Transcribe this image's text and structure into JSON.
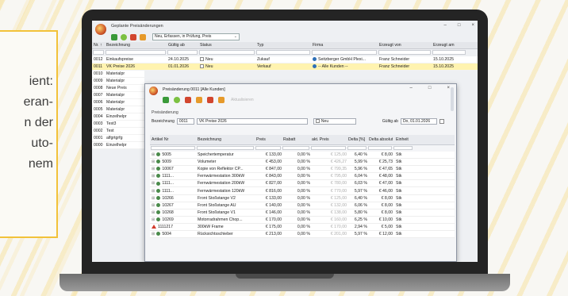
{
  "callout": {
    "lines": [
      "ient:",
      "eran-",
      "n der",
      "uto-",
      "nem"
    ]
  },
  "main_window": {
    "title": "Geplante Preisänderungen",
    "controls": [
      "–",
      "□",
      "×"
    ],
    "filter_value": "Neu, Erfassen, in Prüfung, Preis",
    "columns": [
      "Nr. ↑",
      "Bezeichnung",
      "Gültig ab",
      "Status",
      "Typ",
      "Firma",
      "Erzeugt von",
      "Erzeugt am"
    ],
    "rows": [
      {
        "nr": "0012",
        "bez": "Einkaufspreise",
        "gueltig": "24.10.2025",
        "status": "Neu",
        "typ": "Zukauf",
        "firma": "Seitzberger GmbH Plexi...",
        "von": "Franz Schneider",
        "am": "15.10.2025",
        "highlight": false
      },
      {
        "nr": "0011",
        "bez": "VK Preise 2026",
        "gueltig": "01.01.2026",
        "status": "Neu",
        "typ": "Verkauf",
        "firma": "-- Alle Kunden --",
        "von": "Franz Schneider",
        "am": "15.10.2025",
        "highlight": true
      }
    ],
    "left_rows": [
      {
        "nr": "0010",
        "bez": "Materialpr"
      },
      {
        "nr": "0009",
        "bez": "Materialpr"
      },
      {
        "nr": "0008",
        "bez": "Neue Preis"
      },
      {
        "nr": "0007",
        "bez": "Materialpr"
      },
      {
        "nr": "0006",
        "bez": "Materialpr"
      },
      {
        "nr": "0005",
        "bez": "Materialpr"
      },
      {
        "nr": "0004",
        "bez": "Einzelhelpr"
      },
      {
        "nr": "0003",
        "bez": "Test3"
      },
      {
        "nr": "0002",
        "bez": "Test"
      },
      {
        "nr": "0001",
        "bez": "alfgrtgrfg"
      },
      {
        "nr": "0000",
        "bez": "Einzelhelpr"
      }
    ]
  },
  "dialog": {
    "title": "Preisänderung 0011 [Alle Kunden]",
    "controls": [
      "–",
      "□",
      "×"
    ],
    "toolbar_disabled_label": "Aktualisieren",
    "section": "Preisänderung",
    "bezeichnung_label": "Bezeichnung",
    "nr_value": "0011",
    "bez_value": "VK Preise 2026",
    "status_value": "Neu",
    "gueltig_label": "Gültig ab",
    "gueltig_value": "Do, 01.01.2026",
    "columns": [
      "Artikel Nr",
      "Bezeichnung",
      "Preis",
      "Rabatt",
      "akt. Preis",
      "Delta [%]",
      "Delta absolut",
      "Einheit"
    ],
    "rows": [
      {
        "art": "5005",
        "bez": "Speichertemperatur",
        "preis": "€ 133,00",
        "rabatt": "0,00 %",
        "akt": "€ 125,00",
        "dp": "6,40 %",
        "da": "€ 8,00",
        "eh": "Stk"
      },
      {
        "art": "5009",
        "bez": "Volumeter",
        "preis": "€ 453,00",
        "rabatt": "0,00 %",
        "akt": "€ 426,27",
        "dp": "5,99 %",
        "da": "€ 25,73",
        "eh": "Stk"
      },
      {
        "art": "10067",
        "bez": "Kopie von Reflektor CP...",
        "preis": "€ 847,00",
        "rabatt": "0,00 %",
        "akt": "€ 799,35",
        "dp": "5,96 %",
        "da": "€ 47,65",
        "eh": "Stk"
      },
      {
        "art": "1111...",
        "bez": "Fernwärmestation 300kW",
        "preis": "€ 843,00",
        "rabatt": "0,00 %",
        "akt": "€ 795,00",
        "dp": "6,04 %",
        "da": "€ 48,00",
        "eh": "Stk"
      },
      {
        "art": "1111...",
        "bez": "Fernwärmestation 200kW",
        "preis": "€ 827,00",
        "rabatt": "0,00 %",
        "akt": "€ 780,00",
        "dp": "6,03 %",
        "da": "€ 47,00",
        "eh": "Stk"
      },
      {
        "art": "1111...",
        "bez": "Fernwärmestation 120kW",
        "preis": "€ 816,00",
        "rabatt": "0,00 %",
        "akt": "€ 770,00",
        "dp": "5,97 %",
        "da": "€ 46,00",
        "eh": "Stk"
      },
      {
        "art": "10266",
        "bez": "Front Stoßstange V2",
        "preis": "€ 133,00",
        "rabatt": "0,00 %",
        "akt": "€ 125,00",
        "dp": "6,40 %",
        "da": "€ 8,00",
        "eh": "Stk"
      },
      {
        "art": "10267",
        "bez": "Front Stoßstange AU",
        "preis": "€ 140,00",
        "rabatt": "0,00 %",
        "akt": "€ 132,00",
        "dp": "6,06 %",
        "da": "€ 8,00",
        "eh": "Stk"
      },
      {
        "art": "10268",
        "bez": "Front Stoßstange V1",
        "preis": "€ 146,00",
        "rabatt": "0,00 %",
        "akt": "€ 138,00",
        "dp": "5,80 %",
        "da": "€ 8,00",
        "eh": "Stk"
      },
      {
        "art": "10269",
        "bez": "Motorradrahmen Chop...",
        "preis": "€ 170,00",
        "rabatt": "0,00 %",
        "akt": "€ 160,00",
        "dp": "6,25 %",
        "da": "€ 10,00",
        "eh": "Stk"
      },
      {
        "art": "1111217",
        "bez": "300kW Frame",
        "preis": "€ 175,00",
        "rabatt": "0,00 %",
        "akt": "€ 170,00",
        "dp": "2,94 %",
        "da": "€ 5,00",
        "eh": "Stk"
      },
      {
        "art": "5004",
        "bez": "Rücksichtsschieber",
        "preis": "€ 213,00",
        "rabatt": "0,00 %",
        "akt": "€ 201,00",
        "dp": "5,97 %",
        "da": "€ 12,00",
        "eh": "Stk"
      }
    ]
  },
  "colors": {
    "accent": "#f2c23a",
    "highlight_row": "#fff3b0",
    "bezel": "#242424"
  }
}
